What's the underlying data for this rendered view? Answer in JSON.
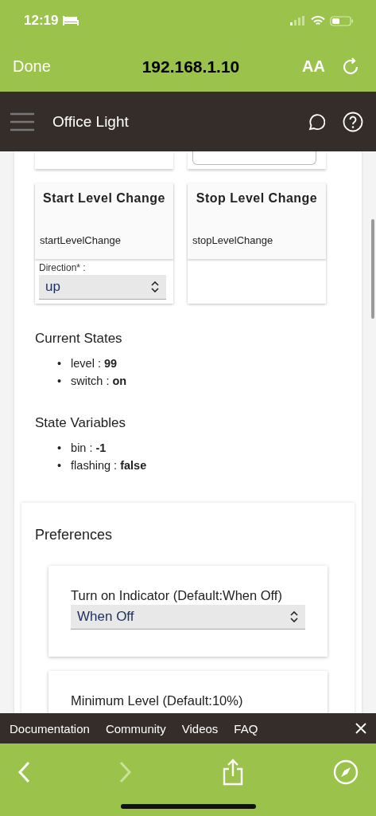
{
  "status_bar": {
    "time": "12:19"
  },
  "browser": {
    "done": "Done",
    "address": "192.168.1.10",
    "text_size": "AA"
  },
  "header": {
    "title": "Office Light"
  },
  "commands": [
    {
      "title": "Start Level Change",
      "method": "startLevelChange",
      "fields": [
        {
          "label": "Direction* :",
          "value": "up"
        }
      ]
    },
    {
      "title": "Stop Level Change",
      "method": "stopLevelChange"
    }
  ],
  "current_states": {
    "title": "Current States",
    "items": [
      {
        "bullet": "•",
        "name": "level : ",
        "value": "99"
      },
      {
        "bullet": "•",
        "name": "switch : ",
        "value": "on"
      }
    ]
  },
  "state_variables": {
    "title": "State Variables",
    "items": [
      {
        "bullet": "•",
        "name": "bin : ",
        "value": "-1"
      },
      {
        "bullet": "•",
        "name": "flashing : ",
        "value": "false"
      }
    ]
  },
  "preferences": {
    "title": "Preferences",
    "items": [
      {
        "label": "Turn on Indicator (Default:When Off)",
        "value": "When Off"
      },
      {
        "label": "Minimum Level (Default:10%)"
      }
    ]
  },
  "footer_links": [
    "Documentation",
    "Community",
    "Videos",
    "FAQ"
  ]
}
